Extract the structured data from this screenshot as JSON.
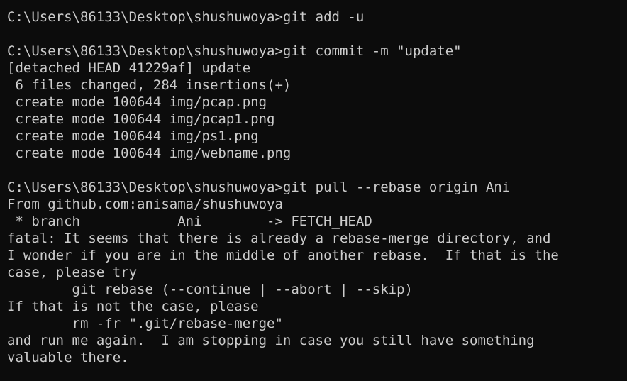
{
  "terminal": {
    "lines": [
      "C:\\Users\\86133\\Desktop\\shushuwoya>git add -u",
      "",
      "C:\\Users\\86133\\Desktop\\shushuwoya>git commit -m \"update\"",
      "[detached HEAD 41229af] update",
      " 6 files changed, 284 insertions(+)",
      " create mode 100644 img/pcap.png",
      " create mode 100644 img/pcap1.png",
      " create mode 100644 img/ps1.png",
      " create mode 100644 img/webname.png",
      "",
      "C:\\Users\\86133\\Desktop\\shushuwoya>git pull --rebase origin Ani",
      "From github.com:anisama/shushuwoya",
      " * branch            Ani        -> FETCH_HEAD",
      "fatal: It seems that there is already a rebase-merge directory, and",
      "I wonder if you are in the middle of another rebase.  If that is the",
      "case, please try",
      "        git rebase (--continue | --abort | --skip)",
      "If that is not the case, please",
      "        rm -fr \".git/rebase-merge\"",
      "and run me again.  I am stopping in case you still have something",
      "valuable there."
    ]
  },
  "colors": {
    "background": "#0c0c0c",
    "text": "#cccccc"
  }
}
